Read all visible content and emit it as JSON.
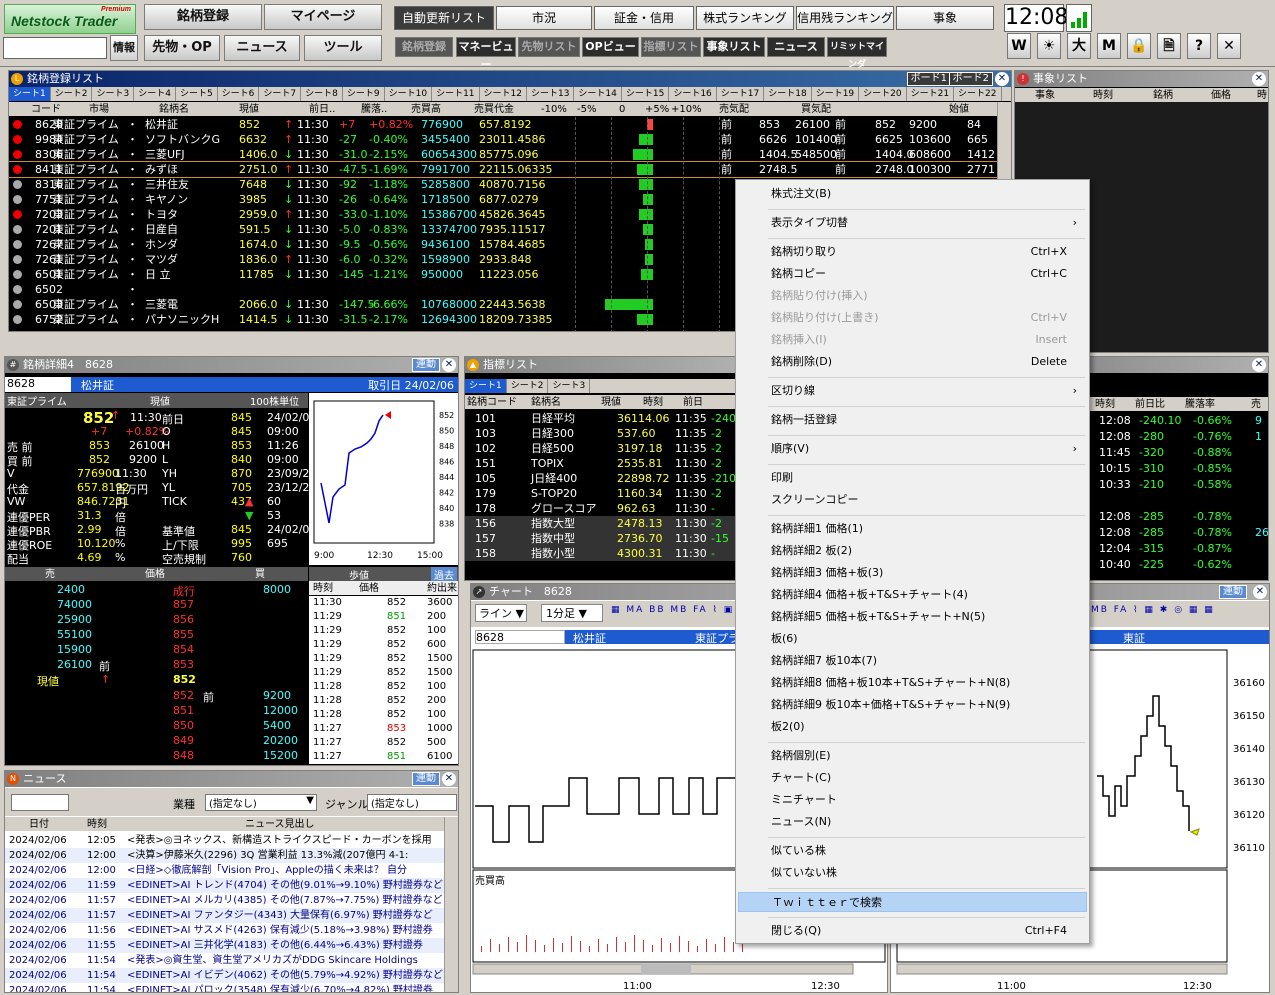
{
  "app": {
    "logo": "Netstock Trader",
    "premium": "Premium"
  },
  "toolbar": {
    "row1_left": [
      "銘柄登録",
      "マイページ"
    ],
    "row2_left": [
      "情報",
      "先物・OP",
      "ニュース",
      "ツール"
    ],
    "tabs": [
      "自動更新リスト",
      "市況",
      "証金・信用",
      "株式ランキング",
      "信用残ランキング",
      "事象"
    ],
    "subtabs": [
      "銘柄登録",
      "マネービュー",
      "先物リスト",
      "OPビュー",
      "指標リスト",
      "事象リスト",
      "ニュース",
      "リミットマインダ"
    ],
    "clock": "12:08",
    "icons": [
      "W",
      "☀",
      "大",
      "M",
      "🔒",
      "🗎",
      "?",
      "✕"
    ]
  },
  "watchlist": {
    "title": "銘柄登録リスト",
    "boards": [
      "ボード1",
      "ボード2"
    ],
    "sheets": [
      "シート1",
      "シート2",
      "シート3",
      "シート4",
      "シート5",
      "シート6",
      "シート7",
      "シート8",
      "シート9",
      "シート10",
      "シート11",
      "シート12",
      "シート13",
      "シート14",
      "シート15",
      "シート16",
      "シート17",
      "シート18",
      "シート19",
      "シート20",
      "シート21",
      "シート22"
    ],
    "headers": [
      "コード",
      "市場",
      "銘柄名",
      "現値",
      "前日..",
      "騰落..",
      "売買高",
      "売買代金",
      "-10%",
      "-5%",
      "0",
      "+5%",
      "+10%",
      "売気配",
      "買気配",
      "始値"
    ],
    "rows": [
      {
        "code": "8628",
        "mkt": "東証プライム",
        "name": "松井証",
        "cur": "852",
        "arrow": "↑",
        "time": "11:30",
        "chg": "+7",
        "pct": "+0.82%",
        "vol": "776900",
        "val": "657.8192",
        "ask": "853",
        "askq": "26100",
        "bid": "852",
        "bidq": "9200",
        "open": "84"
      },
      {
        "code": "9984",
        "mkt": "東証プライム",
        "name": "ソフトバンクG",
        "cur": "6632",
        "arrow": "↑",
        "time": "11:30",
        "chg": "-27",
        "pct": "-0.40%",
        "vol": "3455400",
        "val": "23011.4586",
        "ask": "6626",
        "askq": "101400",
        "bid": "6625",
        "bidq": "103600",
        "open": "665"
      },
      {
        "code": "8306",
        "mkt": "東証プライム",
        "name": "三菱UFJ",
        "cur": "1406.0",
        "arrow": "↓",
        "time": "11:30",
        "chg": "-31.0",
        "pct": "-2.15%",
        "vol": "60654300",
        "val": "85775.096",
        "ask": "1404.5",
        "askq": "548500",
        "bid": "1404.0",
        "bidq": "608600",
        "open": "1412"
      },
      {
        "code": "8411",
        "mkt": "東証プライム",
        "name": "みずほ",
        "cur": "2751.0",
        "arrow": "↑",
        "time": "11:30",
        "chg": "-47.5",
        "pct": "-1.69%",
        "vol": "7991700",
        "val": "22115.06335",
        "ask": "2748.5",
        "askq": "",
        "bid": "2748.0",
        "bidq": "100300",
        "open": "2771"
      },
      {
        "code": "8316",
        "mkt": "東証プライム",
        "name": "三井住友",
        "cur": "7648",
        "arrow": "↓",
        "time": "11:30",
        "chg": "-92",
        "pct": "-1.18%",
        "vol": "5285800",
        "val": "40870.7156",
        "ask": "",
        "askq": "",
        "bid": "",
        "bidq": "",
        "open": ""
      },
      {
        "code": "7751",
        "mkt": "東証プライム",
        "name": "キヤノン",
        "cur": "3985",
        "arrow": "↓",
        "time": "11:30",
        "chg": "-26",
        "pct": "-0.64%",
        "vol": "1718500",
        "val": "6877.0279",
        "ask": "",
        "askq": "",
        "bid": "",
        "bidq": "",
        "open": ""
      },
      {
        "code": "7203",
        "mkt": "東証プライム",
        "name": "トヨタ",
        "cur": "2959.0",
        "arrow": "↑",
        "time": "11:30",
        "chg": "-33.0",
        "pct": "-1.10%",
        "vol": "15386700",
        "val": "45826.3645",
        "ask": "",
        "askq": "",
        "bid": "",
        "bidq": "",
        "open": ""
      },
      {
        "code": "7201",
        "mkt": "東証プライム",
        "name": "日産自",
        "cur": "591.5",
        "arrow": "↓",
        "time": "11:30",
        "chg": "-5.0",
        "pct": "-0.83%",
        "vol": "13374700",
        "val": "7935.11517",
        "ask": "",
        "askq": "",
        "bid": "",
        "bidq": "",
        "open": ""
      },
      {
        "code": "7267",
        "mkt": "東証プライム",
        "name": "ホンダ",
        "cur": "1674.0",
        "arrow": "↓",
        "time": "11:30",
        "chg": "-9.5",
        "pct": "-0.56%",
        "vol": "9436100",
        "val": "15784.4685",
        "ask": "",
        "askq": "",
        "bid": "",
        "bidq": "",
        "open": ""
      },
      {
        "code": "7261",
        "mkt": "東証プライム",
        "name": "マツダ",
        "cur": "1836.0",
        "arrow": "↑",
        "time": "11:30",
        "chg": "-6.0",
        "pct": "-0.32%",
        "vol": "1598900",
        "val": "2933.848",
        "ask": "",
        "askq": "",
        "bid": "",
        "bidq": "",
        "open": ""
      },
      {
        "code": "6501",
        "mkt": "東証プライム",
        "name": "日 立",
        "cur": "11785",
        "arrow": "↓",
        "time": "11:30",
        "chg": "-145",
        "pct": "-1.21%",
        "vol": "950000",
        "val": "11223.056",
        "ask": "",
        "askq": "",
        "bid": "",
        "bidq": "",
        "open": ""
      },
      {
        "code": "6502",
        "mkt": "",
        "name": "",
        "cur": "",
        "arrow": "",
        "time": "",
        "chg": "",
        "pct": "",
        "vol": "",
        "val": "",
        "ask": "",
        "askq": "",
        "bid": "",
        "bidq": "",
        "open": ""
      },
      {
        "code": "6503",
        "mkt": "東証プライム",
        "name": "三菱電",
        "cur": "2066.0",
        "arrow": "↓",
        "time": "11:30",
        "chg": "-147.5",
        "pct": "-6.66%",
        "vol": "10768000",
        "val": "22443.5638",
        "ask": "",
        "askq": "",
        "bid": "",
        "bidq": "",
        "open": ""
      },
      {
        "code": "6752",
        "mkt": "東証プライム",
        "name": "パナソニックH",
        "cur": "1414.5",
        "arrow": "↓",
        "time": "11:30",
        "chg": "-31.5",
        "pct": "-2.17%",
        "vol": "12694300",
        "val": "18209.73385",
        "ask": "",
        "askq": "",
        "bid": "",
        "bidq": "",
        "open": ""
      }
    ]
  },
  "events": {
    "title": "事象リスト",
    "headers": [
      "事象",
      "時刻",
      "銘柄",
      "価格",
      "時"
    ]
  },
  "detail": {
    "title": "銘柄詳細4　8628",
    "rendou": "連動",
    "code": "8628",
    "name": "松井証",
    "date": "取引日 24/02/06",
    "market": "東証プライム",
    "cur_label": "現値",
    "unit": "100株単位",
    "price": "852",
    "arrow": "↑",
    "time": "11:30",
    "chg": "+7",
    "pct": "+0.82%",
    "kv": [
      [
        "前日",
        "845",
        "24/02/05"
      ],
      [
        "O",
        "845",
        "09:00"
      ],
      [
        "H",
        "853",
        "11:26"
      ],
      [
        "L",
        "840",
        "09:00"
      ],
      [
        "YH",
        "870",
        "23/09/20"
      ],
      [
        "YL",
        "705",
        "23/12/25"
      ],
      [
        "TICK",
        "437",
        "60"
      ],
      [
        "",
        "",
        "53"
      ],
      [
        "基準値",
        "845",
        "24/02/06"
      ],
      [
        "上/下限",
        "995",
        "695"
      ],
      [
        "空売規制",
        "760",
        ""
      ]
    ],
    "left": [
      [
        "売 前",
        "853",
        "26100"
      ],
      [
        "買 前",
        "852",
        "9200"
      ],
      [
        "V",
        "776900",
        "11:30"
      ],
      [
        "代金",
        "657.8192",
        "百万円"
      ],
      [
        "VW",
        "846.7231",
        "円"
      ],
      [
        "連優PER",
        "31.3",
        "倍"
      ],
      [
        "連優PBR",
        "2.99",
        "倍"
      ],
      [
        "連優ROE",
        "10.120",
        "%"
      ],
      [
        "配当",
        "4.69",
        "%"
      ]
    ],
    "chart_ticks": [
      "852",
      "850",
      "848",
      "846",
      "844",
      "842",
      "840",
      "838"
    ],
    "chart_times": [
      "9:00",
      "12:30",
      "15:00"
    ],
    "board_headers": [
      "売",
      "価格",
      "買"
    ],
    "board_sell": [
      [
        "2400",
        "成行",
        ""
      ],
      [
        "74000",
        "857",
        ""
      ],
      [
        "25900",
        "856",
        ""
      ],
      [
        "55100",
        "855",
        ""
      ],
      [
        "15900",
        "854",
        ""
      ],
      [
        "26100",
        "853",
        "前"
      ]
    ],
    "board_current": [
      "現値",
      "↑",
      "852"
    ],
    "board_buy": [
      [
        "",
        "852",
        "9200"
      ],
      [
        "",
        "851",
        "12000"
      ],
      [
        "",
        "850",
        "5400"
      ],
      [
        "",
        "849",
        "20200"
      ],
      [
        "",
        "848",
        "15200"
      ]
    ],
    "ticks_header": [
      "歩値",
      "過去"
    ],
    "ticks_cols": [
      "時刻",
      "価格",
      "約出来"
    ],
    "ticks": [
      [
        "11:30",
        "852",
        "3600"
      ],
      [
        "11:29",
        "851",
        "200"
      ],
      [
        "11:29",
        "852",
        "100"
      ],
      [
        "11:29",
        "852",
        "600"
      ],
      [
        "11:29",
        "852",
        "1500"
      ],
      [
        "11:29",
        "852",
        "1500"
      ],
      [
        "11:28",
        "852",
        "100"
      ],
      [
        "11:28",
        "852",
        "200"
      ],
      [
        "11:28",
        "852",
        "100"
      ],
      [
        "11:27",
        "853",
        "1000"
      ],
      [
        "11:27",
        "852",
        "500"
      ],
      [
        "11:27",
        "851",
        "6100"
      ]
    ]
  },
  "index": {
    "title": "指標リスト",
    "sheets": [
      "シート1",
      "シート2",
      "シート3"
    ],
    "headers": [
      "銘柄コード",
      "銘柄名",
      "現値",
      "時刻",
      "前日"
    ],
    "rows": [
      [
        "101",
        "日経平均",
        "36114.06",
        "11:35",
        "-240"
      ],
      [
        "103",
        "日経300",
        "537.60",
        "11:35",
        "-2"
      ],
      [
        "102",
        "日経500",
        "3197.18",
        "11:35",
        "-2"
      ],
      [
        "151",
        "TOPIX",
        "2535.81",
        "11:30",
        "-2"
      ],
      [
        "105",
        "J日経400",
        "22898.72",
        "11:35",
        "-210"
      ],
      [
        "179",
        "S-TOP20",
        "1160.34",
        "11:30",
        "-2"
      ],
      [
        "178",
        "グロースコア",
        "962.63",
        "11:30",
        "-"
      ],
      [
        "156",
        "指数大型",
        "2478.13",
        "11:30",
        "-2"
      ],
      [
        "157",
        "指数中型",
        "2736.70",
        "11:30",
        "-15"
      ],
      [
        "158",
        "指数小型",
        "4300.31",
        "11:30",
        "-"
      ]
    ]
  },
  "rightlist": {
    "headers": [
      "時刻",
      "前日比",
      "騰落率",
      "売"
    ],
    "rows": [
      [
        "12:08",
        "-240.10",
        "-0.66%",
        "9"
      ],
      [
        "12:08",
        "-280",
        "-0.76%",
        "1"
      ],
      [
        "11:45",
        "-320",
        "-0.88%",
        ""
      ],
      [
        "10:15",
        "-310",
        "-0.85%",
        ""
      ],
      [
        "10:33",
        "-210",
        "-0.58%",
        ""
      ],
      [
        "",
        "",
        "",
        ""
      ],
      [
        "12:08",
        "-285",
        "-0.78%",
        ""
      ],
      [
        "12:08",
        "-285",
        "-0.78%",
        "26"
      ],
      [
        "12:04",
        "-315",
        "-0.87%",
        ""
      ],
      [
        "10:40",
        "-225",
        "-0.62%",
        ""
      ]
    ]
  },
  "chart": {
    "title": "チャート　8628",
    "code": "8628",
    "name": "松井証",
    "market": "東証プライム",
    "type": "ライン",
    "period": "1分足",
    "vol_label": "売買高",
    "times": [
      "11:00",
      "12:30"
    ],
    "rendou": "連動"
  },
  "chart2": {
    "market": "東証",
    "ticks": [
      "36160",
      "36150",
      "36140",
      "36130",
      "36120",
      "36110"
    ],
    "times": [
      "11:00",
      "12:30"
    ]
  },
  "news": {
    "title": "ニュース",
    "rendou": "連動",
    "industry_label": "業種",
    "industry_value": "(指定なし)",
    "genre_label": "ジャンル",
    "genre_value": "(指定なし)",
    "headers": [
      "日付",
      "時刻",
      "ニュース見出し"
    ],
    "rows": [
      [
        "2024/02/06",
        "12:05",
        "<発表>◎ヨネックス、新構造ストライクスピード・カーボンを採用"
      ],
      [
        "2024/02/06",
        "12:00",
        "<決算>伊藤米久(2296) 3Q 営業利益 13.3%減(207億円 4-1:"
      ],
      [
        "2024/02/06",
        "12:00",
        "<日経>◇徹底解剖「Vision Pro」、Appleの描く未来は？ 自分"
      ],
      [
        "2024/02/06",
        "11:59",
        "<EDINET>AI トレンド(4704) その他(9.01%→9.10%) 野村證券など"
      ],
      [
        "2024/02/06",
        "11:57",
        "<EDINET>AI メルカリ(4385) その他(7.87%→7.75%) 野村證券など"
      ],
      [
        "2024/02/06",
        "11:57",
        "<EDINET>AI ファンタジー(4343) 大量保有(6.97%) 野村證券など"
      ],
      [
        "2024/02/06",
        "11:56",
        "<EDINET>AI サスメド(4263) 保有減少(5.18%→3.98%) 野村證券"
      ],
      [
        "2024/02/06",
        "11:55",
        "<EDINET>AI 三井化学(4183) その他(6.44%→6.43%) 野村證券"
      ],
      [
        "2024/02/06",
        "11:54",
        "<発表>◎資生堂、資生堂アメリカズがDDG Skincare Holdings"
      ],
      [
        "2024/02/06",
        "11:54",
        "<EDINET>AI イビデン(4062) その他(5.79%→4.92%) 野村證券など"
      ],
      [
        "2024/02/06",
        "11:54",
        "<EDINET>AI パロック(3548) 保有減少(6.70%→4.82%) 野村證券"
      ]
    ]
  },
  "context_menu": {
    "items": [
      {
        "label": "株式注文(B)",
        "sc": "",
        "dis": false
      },
      {
        "sep": true
      },
      {
        "label": "表示タイプ切替",
        "sc": "",
        "arrow": true,
        "dis": false
      },
      {
        "sep": true
      },
      {
        "label": "銘柄切り取り",
        "sc": "Ctrl+X",
        "dis": false
      },
      {
        "label": "銘柄コピー",
        "sc": "Ctrl+C",
        "dis": false
      },
      {
        "label": "銘柄貼り付け(挿入)",
        "sc": "",
        "dis": true
      },
      {
        "label": "銘柄貼り付け(上書き)",
        "sc": "Ctrl+V",
        "dis": true
      },
      {
        "label": "銘柄挿入(I)",
        "sc": "Insert",
        "dis": true
      },
      {
        "label": "銘柄削除(D)",
        "sc": "Delete",
        "dis": false
      },
      {
        "sep": true
      },
      {
        "label": "区切り線",
        "sc": "",
        "arrow": true,
        "dis": false
      },
      {
        "sep": true
      },
      {
        "label": "銘柄一括登録",
        "sc": "",
        "dis": false
      },
      {
        "sep": true
      },
      {
        "label": "順序(V)",
        "sc": "",
        "arrow": true,
        "dis": false
      },
      {
        "sep": true
      },
      {
        "label": "印刷",
        "sc": "",
        "dis": false
      },
      {
        "label": "スクリーンコピー",
        "sc": "",
        "dis": false
      },
      {
        "sep": true
      },
      {
        "label": "銘柄詳細1 価格(1)",
        "sc": "",
        "dis": false
      },
      {
        "label": "銘柄詳細2 板(2)",
        "sc": "",
        "dis": false
      },
      {
        "label": "銘柄詳細3 価格+板(3)",
        "sc": "",
        "dis": false
      },
      {
        "label": "銘柄詳細4 価格+板+T&S+チャート(4)",
        "sc": "",
        "dis": false
      },
      {
        "label": "銘柄詳細5 価格+板+T&S+チャート+N(5)",
        "sc": "",
        "dis": false
      },
      {
        "label": "板(6)",
        "sc": "",
        "dis": false
      },
      {
        "label": "銘柄詳細7 板10本(7)",
        "sc": "",
        "dis": false
      },
      {
        "label": "銘柄詳細8 価格+板10本+T&S+チャート+N(8)",
        "sc": "",
        "dis": false
      },
      {
        "label": "銘柄詳細9 板10本+価格+T&S+チャート+N(9)",
        "sc": "",
        "dis": false
      },
      {
        "label": "板2(0)",
        "sc": "",
        "dis": false
      },
      {
        "sep": true
      },
      {
        "label": "銘柄個別(E)",
        "sc": "",
        "dis": false
      },
      {
        "label": "チャート(C)",
        "sc": "",
        "dis": false
      },
      {
        "label": "ミニチャート",
        "sc": "",
        "dis": false
      },
      {
        "label": "ニュース(N)",
        "sc": "",
        "dis": false
      },
      {
        "sep": true
      },
      {
        "label": "似ている株",
        "sc": "",
        "dis": false
      },
      {
        "label": "似ていない株",
        "sc": "",
        "dis": false
      },
      {
        "sep": true
      },
      {
        "label": "Ｔｗｉｔｔｅｒで検索",
        "sc": "",
        "dis": false,
        "hl": true
      },
      {
        "sep": true
      },
      {
        "label": "閉じる(Q)",
        "sc": "Ctrl+F4",
        "dis": false
      }
    ]
  },
  "colors": {
    "accent": "#0a246a",
    "up": "#ff3030",
    "down": "#30ff30",
    "menu_highlight": "#b5d3f5"
  }
}
